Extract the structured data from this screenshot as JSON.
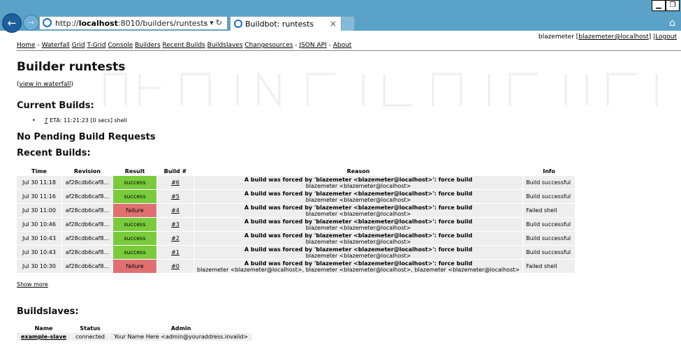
{
  "browser": {
    "url_prefix": "http://",
    "url_host": "localhost",
    "url_rest": ":8010/builders/runtests",
    "tab_title": "Buildbot: runtests",
    "tab_close": "×"
  },
  "userbar": {
    "user": "blazemeter",
    "login_link": "blazemeter@localhost",
    "logout": "Logout"
  },
  "nav": {
    "home": "Home",
    "waterfall": "Waterfall",
    "grid": "Grid",
    "tgrid": "T-Grid",
    "console": "Console",
    "builders": "Builders",
    "recent_builds": "Recent Builds",
    "buildslaves": "Buildslaves",
    "changesources": "Changesources",
    "json_api": "JSON API",
    "about": "About"
  },
  "page": {
    "title": "Builder runtests",
    "view_in_waterfall": "view in waterfall",
    "current_builds_heading": "Current Builds:",
    "current_build_link": "7",
    "current_build_text": " ETA: 11:21:23 [0 secs] shell",
    "pending_heading": "No Pending Build Requests",
    "recent_heading": "Recent Builds:",
    "show_more": "Show more",
    "buildslaves_heading": "Buildslaves:"
  },
  "recent_builds": {
    "headers": [
      "Time",
      "Revision",
      "Result",
      "Build #",
      "Reason",
      "Info"
    ],
    "rows": [
      {
        "time": "Jul 30 11:18",
        "revision": "af28cdb6caf8...",
        "result": "success",
        "build": "#6",
        "reason": "A build was forced by 'blazemeter <blazemeter@localhost>': force build",
        "by": "blazemeter <blazemeter@localhost>",
        "info": "Build successful"
      },
      {
        "time": "Jul 30 11:16",
        "revision": "af28cdb6caf8...",
        "result": "success",
        "build": "#5",
        "reason": "A build was forced by 'blazemeter <blazemeter@localhost>': force build",
        "by": "blazemeter <blazemeter@localhost>",
        "info": "Build successful"
      },
      {
        "time": "Jul 30 11:00",
        "revision": "af28cdb6caf8...",
        "result": "failure",
        "build": "#4",
        "reason": "A build was forced by 'blazemeter <blazemeter@localhost>': force build",
        "by": "blazemeter <blazemeter@localhost>",
        "info": "Failed shell"
      },
      {
        "time": "Jul 30 10:46",
        "revision": "af28cdb6caf8...",
        "result": "success",
        "build": "#3",
        "reason": "A build was forced by 'blazemeter <blazemeter@localhost>': force build",
        "by": "blazemeter <blazemeter@localhost>",
        "info": "Build successful"
      },
      {
        "time": "Jul 30 10:43",
        "revision": "af28cdb6caf8...",
        "result": "success",
        "build": "#2",
        "reason": "A build was forced by 'blazemeter <blazemeter@localhost>': force build",
        "by": "blazemeter <blazemeter@localhost>",
        "info": "Build successful"
      },
      {
        "time": "Jul 30 10:43",
        "revision": "af28cdb6caf8...",
        "result": "success",
        "build": "#1",
        "reason": "A build was forced by 'blazemeter <blazemeter@localhost>': force build",
        "by": "blazemeter <blazemeter@localhost>",
        "info": "Build successful"
      },
      {
        "time": "Jul 30 10:30",
        "revision": "af28cdb6caf8...",
        "result": "failure",
        "build": "#0",
        "reason": "A build was forced by 'blazemeter <blazemeter@localhost>': force build",
        "by": "blazemeter <blazemeter@localhost>, blazemeter <blazemeter@localhost>, blazemeter <blazemeter@localhost>",
        "info": "Failed shell"
      }
    ]
  },
  "buildslaves": {
    "headers": [
      "Name",
      "Status",
      "Admin"
    ],
    "rows": [
      {
        "name": "example-slave",
        "status": "connected",
        "admin": "Your Name Here <admin@youraddress.invalid>"
      }
    ]
  },
  "colors": {
    "success": "#7acb3c",
    "failure": "#e07070",
    "chrome": "#5aa2c8"
  },
  "icons": [
    "back-arrow-icon",
    "forward-arrow-icon",
    "ie-logo-icon",
    "search-icon",
    "refresh-icon",
    "home-icon",
    "minimize-icon",
    "restore-icon",
    "close-icon"
  ]
}
